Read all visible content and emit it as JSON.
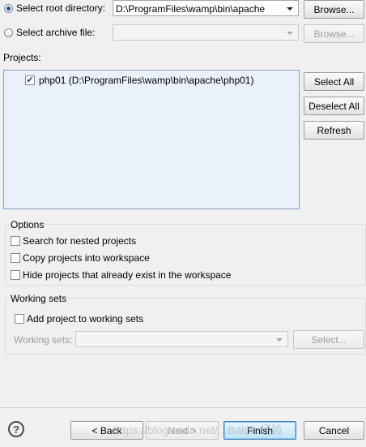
{
  "source": {
    "root_label": "Select root directory:",
    "root_path": "D:\\ProgramFiles\\wamp\\bin\\apache",
    "root_browse": "Browse...",
    "archive_label": "Select archive file:",
    "archive_value": "",
    "archive_browse": "Browse..."
  },
  "projects": {
    "label": "Projects:",
    "items": [
      {
        "label": "php01 (D:\\ProgramFiles\\wamp\\bin\\apache\\php01)",
        "checked": true
      }
    ],
    "select_all": "Select All",
    "deselect_all": "Deselect All",
    "refresh": "Refresh"
  },
  "options": {
    "title": "Options",
    "nested": "Search for nested projects",
    "copy": "Copy projects into workspace",
    "hide": "Hide projects that already exist in the workspace"
  },
  "working_sets": {
    "title": "Working sets",
    "add": "Add project to working sets",
    "label": "Working sets:",
    "value": "",
    "select": "Select..."
  },
  "footer": {
    "help_icon": "help-icon",
    "back": "< Back",
    "next": "Next >",
    "finish": "Finish",
    "cancel": "Cancel"
  },
  "watermark": "https://blog.csdn.net/...Baidu 经验"
}
